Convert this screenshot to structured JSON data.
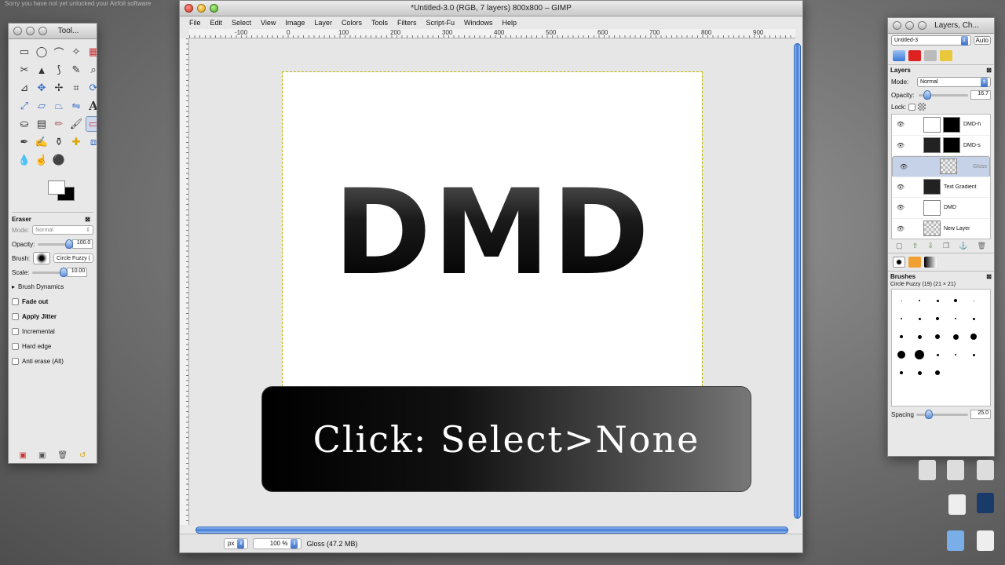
{
  "desktop": {
    "top_text": "Sorry you have not yet unlocked your Airfoil software"
  },
  "image_window": {
    "title": "*Untitled-3.0 (RGB, 7 layers) 800x800 – GIMP",
    "menu": [
      "File",
      "Edit",
      "Select",
      "View",
      "Image",
      "Layer",
      "Colors",
      "Tools",
      "Filters",
      "Script-Fu",
      "Windows",
      "Help"
    ],
    "ruler_labels": [
      "-100",
      "0",
      "100",
      "200",
      "300",
      "400",
      "500",
      "600",
      "700",
      "800",
      "900"
    ],
    "canvas_text": "DMD",
    "status": {
      "unit": "px",
      "zoom": "100 %",
      "info": "Gloss (47.2 MB)"
    }
  },
  "caption": {
    "text": "Click: Select>None"
  },
  "toolbox": {
    "title": "Tool...",
    "options_title": "Eraser",
    "mode_label": "Mode:",
    "mode_value": "Normal",
    "opacity_label": "Opacity:",
    "opacity_value": "100.0",
    "opacity_frac": 1.0,
    "brush_label": "Brush:",
    "brush_value": "Circle Fuzzy (",
    "scale_label": "Scale:",
    "scale_value": "10.00",
    "scale_frac": 1.0,
    "dynamics_label": "Brush Dynamics",
    "checkboxes": [
      "Fade out",
      "Apply Jitter",
      "Incremental",
      "Hard edge",
      "Anti erase  (Alt)"
    ]
  },
  "dock": {
    "title": "Layers, Ch...",
    "image_select": "Untitled-3",
    "auto_label": "Auto",
    "layers_title": "Layers",
    "mode_label": "Mode:",
    "mode_value": "Normal",
    "opacity_label": "Opacity:",
    "opacity_value": "16.7",
    "opacity_frac": 0.167,
    "lock_label": "Lock:",
    "layers": [
      {
        "name": "DMD-h",
        "thumb": "white",
        "mask": true,
        "selected": false
      },
      {
        "name": "DMD-s",
        "thumb": "dark",
        "mask": true,
        "selected": false
      },
      {
        "name": "Gloss",
        "thumb": "checker",
        "mask": false,
        "selected": true
      },
      {
        "name": "Text Gradient",
        "thumb": "dark",
        "mask": false,
        "selected": false
      },
      {
        "name": "DMD",
        "thumb": "white",
        "mask": false,
        "selected": false
      },
      {
        "name": "New Layer",
        "thumb": "checker",
        "mask": false,
        "selected": false
      }
    ],
    "brushes_title": "Brushes",
    "brush_name": "Circle Fuzzy (19) (21 × 21)",
    "spacing_label": "Spacing",
    "spacing_value": "25.0",
    "spacing_frac": 0.25
  }
}
